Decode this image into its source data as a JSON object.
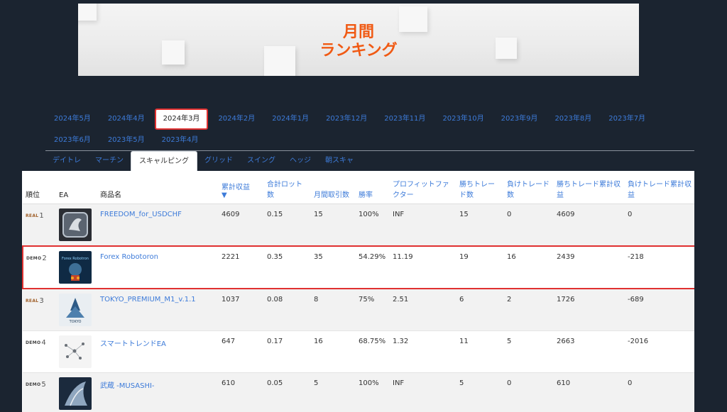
{
  "banner": {
    "title_line1": "月間",
    "title_line2": "ランキング",
    "accent": "#f05a14"
  },
  "month_tabs": [
    {
      "label": "2024年5月",
      "active": false
    },
    {
      "label": "2024年4月",
      "active": false
    },
    {
      "label": "2024年3月",
      "active": true
    },
    {
      "label": "2024年2月",
      "active": false
    },
    {
      "label": "2024年1月",
      "active": false
    },
    {
      "label": "2023年12月",
      "active": false
    },
    {
      "label": "2023年11月",
      "active": false
    },
    {
      "label": "2023年10月",
      "active": false
    },
    {
      "label": "2023年9月",
      "active": false
    },
    {
      "label": "2023年8月",
      "active": false
    },
    {
      "label": "2023年7月",
      "active": false
    },
    {
      "label": "2023年6月",
      "active": false
    },
    {
      "label": "2023年5月",
      "active": false
    },
    {
      "label": "2023年4月",
      "active": false
    }
  ],
  "style_tabs": [
    {
      "label": "デイトレ",
      "active": false
    },
    {
      "label": "マーチン",
      "active": false
    },
    {
      "label": "スキャルピング",
      "active": true
    },
    {
      "label": "グリッド",
      "active": false
    },
    {
      "label": "スイング",
      "active": false
    },
    {
      "label": "ヘッジ",
      "active": false
    },
    {
      "label": "朝スキャ",
      "active": false
    }
  ],
  "table": {
    "headers": {
      "rank": "順位",
      "ea": "EA",
      "product": "商品名",
      "cumulative_profit": "累計収益",
      "sort_indicator": "▼",
      "total_lots": "合計ロット数",
      "monthly_trades": "月間取引数",
      "win_rate": "勝率",
      "profit_factor": "プロフィットファクター",
      "win_trades": "勝ちトレード数",
      "loss_trades": "負けトレード数",
      "win_cumulative": "勝ちトレード累計収益",
      "loss_cumulative": "負けトレード累計収益"
    },
    "rows": [
      {
        "type": "REAL",
        "rank": "1",
        "product": "FREEDOM_for_USDCHF",
        "cumulative_profit": "4609",
        "total_lots": "0.15",
        "monthly_trades": "15",
        "win_rate": "100%",
        "profit_factor": "INF",
        "win_trades": "15",
        "loss_trades": "0",
        "win_cumulative": "4609",
        "loss_cumulative": "0",
        "highlight": false,
        "img_icon": "freedom-logo-icon"
      },
      {
        "type": "DEMO",
        "rank": "2",
        "product": "Forex Robotoron",
        "cumulative_profit": "2221",
        "total_lots": "0.35",
        "monthly_trades": "35",
        "win_rate": "54.29%",
        "profit_factor": "11.19",
        "win_trades": "19",
        "loss_trades": "16",
        "win_cumulative": "2439",
        "loss_cumulative": "-218",
        "highlight": true,
        "img_icon": "robot-logo-icon"
      },
      {
        "type": "REAL",
        "rank": "3",
        "product": "TOKYO_PREMIUM_M1_v.1.1",
        "cumulative_profit": "1037",
        "total_lots": "0.08",
        "monthly_trades": "8",
        "win_rate": "75%",
        "profit_factor": "2.51",
        "win_trades": "6",
        "loss_trades": "2",
        "win_cumulative": "1726",
        "loss_cumulative": "-689",
        "highlight": false,
        "img_icon": "tokyo-logo-icon"
      },
      {
        "type": "DEMO",
        "rank": "4",
        "product": "スマートトレンドEA",
        "cumulative_profit": "647",
        "total_lots": "0.17",
        "monthly_trades": "16",
        "win_rate": "68.75%",
        "profit_factor": "1.32",
        "win_trades": "11",
        "loss_trades": "5",
        "win_cumulative": "2663",
        "loss_cumulative": "-2016",
        "highlight": false,
        "img_icon": "network-logo-icon"
      },
      {
        "type": "DEMO",
        "rank": "5",
        "product": "武蔵 -MUSASHI-",
        "cumulative_profit": "610",
        "total_lots": "0.05",
        "monthly_trades": "5",
        "win_rate": "100%",
        "profit_factor": "INF",
        "win_trades": "5",
        "loss_trades": "0",
        "win_cumulative": "610",
        "loss_cumulative": "0",
        "highlight": false,
        "img_icon": "samurai-logo-icon"
      }
    ]
  },
  "colors": {
    "background": "#1b2430",
    "link": "#3d7bd9",
    "highlight_border": "#e03030"
  }
}
